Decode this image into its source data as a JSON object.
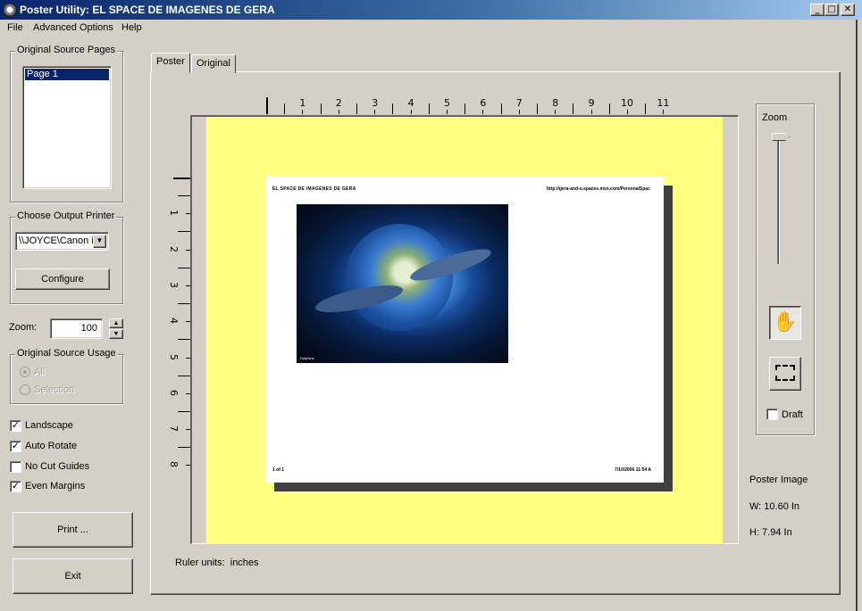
{
  "window": {
    "title": "Poster Utility:  EL SPACE DE IMAGENES DE GERA",
    "controls": {
      "minimize": "_",
      "maximize": "□",
      "close": "✕"
    }
  },
  "menu": [
    "File",
    "Advanced Options",
    "Help"
  ],
  "left_panel": {
    "source_pages": {
      "label": "Original Source Pages",
      "items": [
        {
          "label": "Page 1",
          "selected": true
        }
      ]
    },
    "printer": {
      "label": "Choose Output Printer",
      "selected": "\\\\JOYCE\\Canon iP",
      "configure_label": "Configure"
    },
    "zoom": {
      "label": "Zoom:",
      "value": "100"
    },
    "source_usage": {
      "label": "Original Source Usage",
      "options": [
        {
          "label": "All",
          "checked": true,
          "disabled": true
        },
        {
          "label": "Selection",
          "checked": false,
          "disabled": true
        }
      ]
    },
    "checkboxes": [
      {
        "label": "Landscape",
        "checked": true
      },
      {
        "label": "Auto Rotate",
        "checked": true
      },
      {
        "label": "No Cut Guides",
        "checked": false
      },
      {
        "label": "Even Margins",
        "checked": true
      }
    ],
    "print_label": "Print ...",
    "exit_label": "Exit"
  },
  "tabs": [
    {
      "label": "Poster",
      "active": true
    },
    {
      "label": "Original",
      "active": false
    }
  ],
  "ruler": {
    "units_label": "Ruler units:  inches",
    "horizontal_labels": [
      "1",
      "2",
      "3",
      "4",
      "5",
      "6",
      "7",
      "8",
      "9",
      "10",
      "11"
    ],
    "vertical_labels": [
      "1",
      "2",
      "3",
      "4",
      "5",
      "6",
      "7",
      "8"
    ]
  },
  "preview": {
    "header_left": "EL SPACE DE IMAGENES DE GERA",
    "header_right": "http://gera-and-o.spaces.msn.com/PersonalSpac",
    "footer_left": "1 of 1",
    "footer_right": "7/10/2006 11:54 A",
    "image_caption": "Dolphins"
  },
  "right_panel": {
    "zoom_label": "Zoom",
    "zoom_slider_level": 0,
    "draft_label": "Draft",
    "draft_checked": false,
    "poster_image_label": "Poster Image",
    "width_text": "W: 10.60 In",
    "height_text": "H: 7.94 In"
  },
  "colors": {
    "poster_background": "#ffff80",
    "selection": "#0a246a",
    "window_bg": "#d4d0c8"
  }
}
